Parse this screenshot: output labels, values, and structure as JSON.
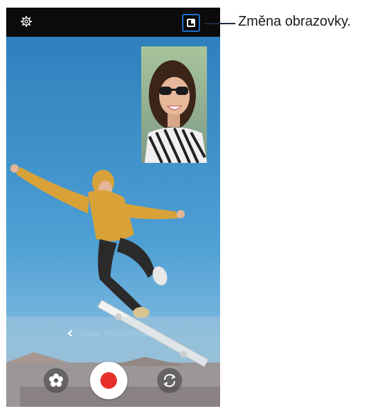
{
  "toolbar": {
    "settings_icon": "gear-icon",
    "screen_change_icon": "picture-in-picture-icon"
  },
  "mode_selector": {
    "label": "DUAL RECORDING",
    "back_icon": "chevron-left-icon"
  },
  "controls": {
    "effect_icon": "flower-effect-icon",
    "record_icon": "record-dot-icon",
    "switch_icon": "camera-switch-icon",
    "record_color": "#e8302b"
  },
  "callout": {
    "text": "Změna obrazovky."
  },
  "colors": {
    "accent": "#1e6fd0",
    "sky": "#3d8cc4"
  }
}
